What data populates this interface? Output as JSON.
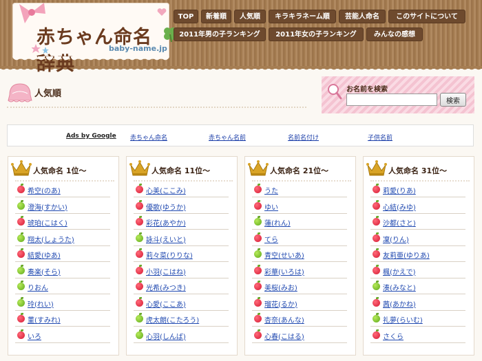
{
  "header": {
    "site_title": "赤ちゃん命名辞典",
    "site_url": "baby-name.jp",
    "nav": [
      "TOP",
      "新着順",
      "人気順",
      "キラキラネーム順",
      "芸能人命名",
      "このサイトについて",
      "2011年男の子ランキング",
      "2011年女の子ランキング",
      "みんなの感想"
    ]
  },
  "page_title": "人気順",
  "search": {
    "label": "お名前を検索",
    "value": "",
    "button": "検索"
  },
  "ads": {
    "sponsor": "Ads by Google",
    "links": [
      "赤ちゃん命名",
      "赤ちゃん名前",
      "名前名付け",
      "子供名前"
    ]
  },
  "columns": [
    {
      "title": "人気命名 1位〜",
      "items": [
        {
          "name": "希空(のあ)",
          "apple": "red"
        },
        {
          "name": "澄海(すかい)",
          "apple": "green"
        },
        {
          "name": "琥珀(こはく)",
          "apple": "red"
        },
        {
          "name": "翔太(しょうた)",
          "apple": "green"
        },
        {
          "name": "結愛(ゆあ)",
          "apple": "red"
        },
        {
          "name": "奏楽(そら)",
          "apple": "green"
        },
        {
          "name": "りおん",
          "apple": "green"
        },
        {
          "name": "玲(れい)",
          "apple": "green"
        },
        {
          "name": "菫(すみれ)",
          "apple": "red"
        },
        {
          "name": "いろ",
          "apple": "red"
        }
      ]
    },
    {
      "title": "人気命名 11位〜",
      "items": [
        {
          "name": "心美(ここみ)",
          "apple": "red"
        },
        {
          "name": "優歌(ゆうか)",
          "apple": "red"
        },
        {
          "name": "彩花(あやか)",
          "apple": "red"
        },
        {
          "name": "詠斗(えいと)",
          "apple": "green"
        },
        {
          "name": "莉々菜(りりな)",
          "apple": "red"
        },
        {
          "name": "小羽(こはね)",
          "apple": "red"
        },
        {
          "name": "光希(みつき)",
          "apple": "red"
        },
        {
          "name": "心愛(ここあ)",
          "apple": "red"
        },
        {
          "name": "虎太朗(こたろう)",
          "apple": "green"
        },
        {
          "name": "心羽(しんば)",
          "apple": "green"
        }
      ]
    },
    {
      "title": "人気命名 21位〜",
      "items": [
        {
          "name": "うた",
          "apple": "red"
        },
        {
          "name": "ゆい",
          "apple": "red"
        },
        {
          "name": "蓮(れん)",
          "apple": "green"
        },
        {
          "name": "てら",
          "apple": "red"
        },
        {
          "name": "青空(せいあ)",
          "apple": "green"
        },
        {
          "name": "彩華(いろは)",
          "apple": "red"
        },
        {
          "name": "美桜(みお)",
          "apple": "red"
        },
        {
          "name": "瑠花(るか)",
          "apple": "red"
        },
        {
          "name": "杏奈(あんな)",
          "apple": "red"
        },
        {
          "name": "心春(こはる)",
          "apple": "red"
        }
      ]
    },
    {
      "title": "人気命名 31位〜",
      "items": [
        {
          "name": "莉愛(りあ)",
          "apple": "red"
        },
        {
          "name": "心結(みゆ)",
          "apple": "red"
        },
        {
          "name": "沙都(さと)",
          "apple": "red"
        },
        {
          "name": "凜(りん)",
          "apple": "red"
        },
        {
          "name": "友莉亜(ゆりあ)",
          "apple": "red"
        },
        {
          "name": "楓(かえで)",
          "apple": "red"
        },
        {
          "name": "湊(みなと)",
          "apple": "green"
        },
        {
          "name": "茜(あかね)",
          "apple": "red"
        },
        {
          "name": "礼夢(らいむ)",
          "apple": "green"
        },
        {
          "name": "さくら",
          "apple": "red"
        }
      ]
    }
  ]
}
